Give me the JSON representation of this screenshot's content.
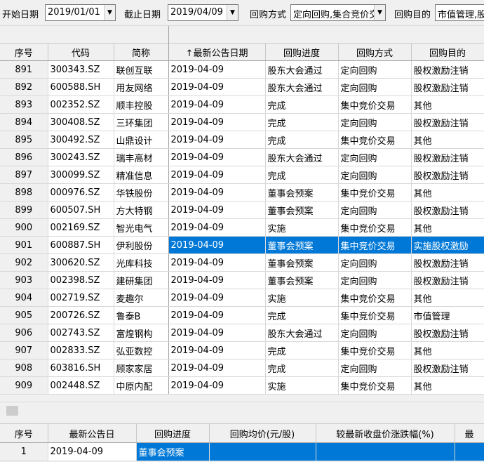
{
  "filters": {
    "start_label": "开始日期",
    "start_value": "2019/01/01",
    "end_label": "截止日期",
    "end_value": "2019/04/09",
    "method_label": "回购方式",
    "method_value": "定向回购,集合竞价交易",
    "purpose_label": "回购目的",
    "purpose_value": "市值管理,股权激励"
  },
  "grid": {
    "columns": [
      "序号",
      "代码",
      "简称",
      "↑最新公告日期",
      "回购进度",
      "回购方式",
      "回购目的"
    ],
    "selected_index": 10,
    "rows": [
      [
        "891",
        "300343.SZ",
        "联创互联",
        "2019-04-09",
        "股东大会通过",
        "定向回购",
        "股权激励注销"
      ],
      [
        "892",
        "600588.SH",
        "用友网络",
        "2019-04-09",
        "股东大会通过",
        "定向回购",
        "股权激励注销"
      ],
      [
        "893",
        "002352.SZ",
        "顺丰控股",
        "2019-04-09",
        "完成",
        "集中竞价交易",
        "其他"
      ],
      [
        "894",
        "300408.SZ",
        "三环集团",
        "2019-04-09",
        "完成",
        "定向回购",
        "股权激励注销"
      ],
      [
        "895",
        "300492.SZ",
        "山鼎设计",
        "2019-04-09",
        "完成",
        "集中竞价交易",
        "其他"
      ],
      [
        "896",
        "300243.SZ",
        "瑞丰高材",
        "2019-04-09",
        "股东大会通过",
        "定向回购",
        "股权激励注销"
      ],
      [
        "897",
        "300099.SZ",
        "精准信息",
        "2019-04-09",
        "完成",
        "定向回购",
        "股权激励注销"
      ],
      [
        "898",
        "000976.SZ",
        "华铁股份",
        "2019-04-09",
        "董事会预案",
        "集中竞价交易",
        "其他"
      ],
      [
        "899",
        "600507.SH",
        "方大特钢",
        "2019-04-09",
        "董事会预案",
        "定向回购",
        "股权激励注销"
      ],
      [
        "900",
        "002169.SZ",
        "智光电气",
        "2019-04-09",
        "实施",
        "集中竞价交易",
        "其他"
      ],
      [
        "901",
        "600887.SH",
        "伊利股份",
        "2019-04-09",
        "董事会预案",
        "集中竞价交易",
        "实施股权激励"
      ],
      [
        "902",
        "300620.SZ",
        "光库科技",
        "2019-04-09",
        "董事会预案",
        "定向回购",
        "股权激励注销"
      ],
      [
        "903",
        "002398.SZ",
        "建研集团",
        "2019-04-09",
        "董事会预案",
        "定向回购",
        "股权激励注销"
      ],
      [
        "904",
        "002719.SZ",
        "麦趣尔",
        "2019-04-09",
        "实施",
        "集中竞价交易",
        "其他"
      ],
      [
        "905",
        "200726.SZ",
        "鲁泰B",
        "2019-04-09",
        "完成",
        "集中竞价交易",
        "市值管理"
      ],
      [
        "906",
        "002743.SZ",
        "富煌钢构",
        "2019-04-09",
        "股东大会通过",
        "定向回购",
        "股权激励注销"
      ],
      [
        "907",
        "002833.SZ",
        "弘亚数控",
        "2019-04-09",
        "完成",
        "集中竞价交易",
        "其他"
      ],
      [
        "908",
        "603816.SH",
        "顾家家居",
        "2019-04-09",
        "完成",
        "定向回购",
        "股权激励注销"
      ],
      [
        "909",
        "002448.SZ",
        "中原内配",
        "2019-04-09",
        "实施",
        "集中竞价交易",
        "其他"
      ]
    ]
  },
  "detail": {
    "columns": [
      "序号",
      "最新公告日",
      "回购进度",
      "回购均价(元/股)",
      "较最新收盘价涨跌幅(%)",
      "最"
    ],
    "rows": [
      [
        "1",
        "2019-04-09",
        "董事会预案",
        "",
        "",
        ""
      ]
    ]
  },
  "icons": {
    "dropdown": "chevron-down-icon"
  },
  "colors": {
    "selection": "#0078d7",
    "header_bg": "#f0f0f0"
  }
}
